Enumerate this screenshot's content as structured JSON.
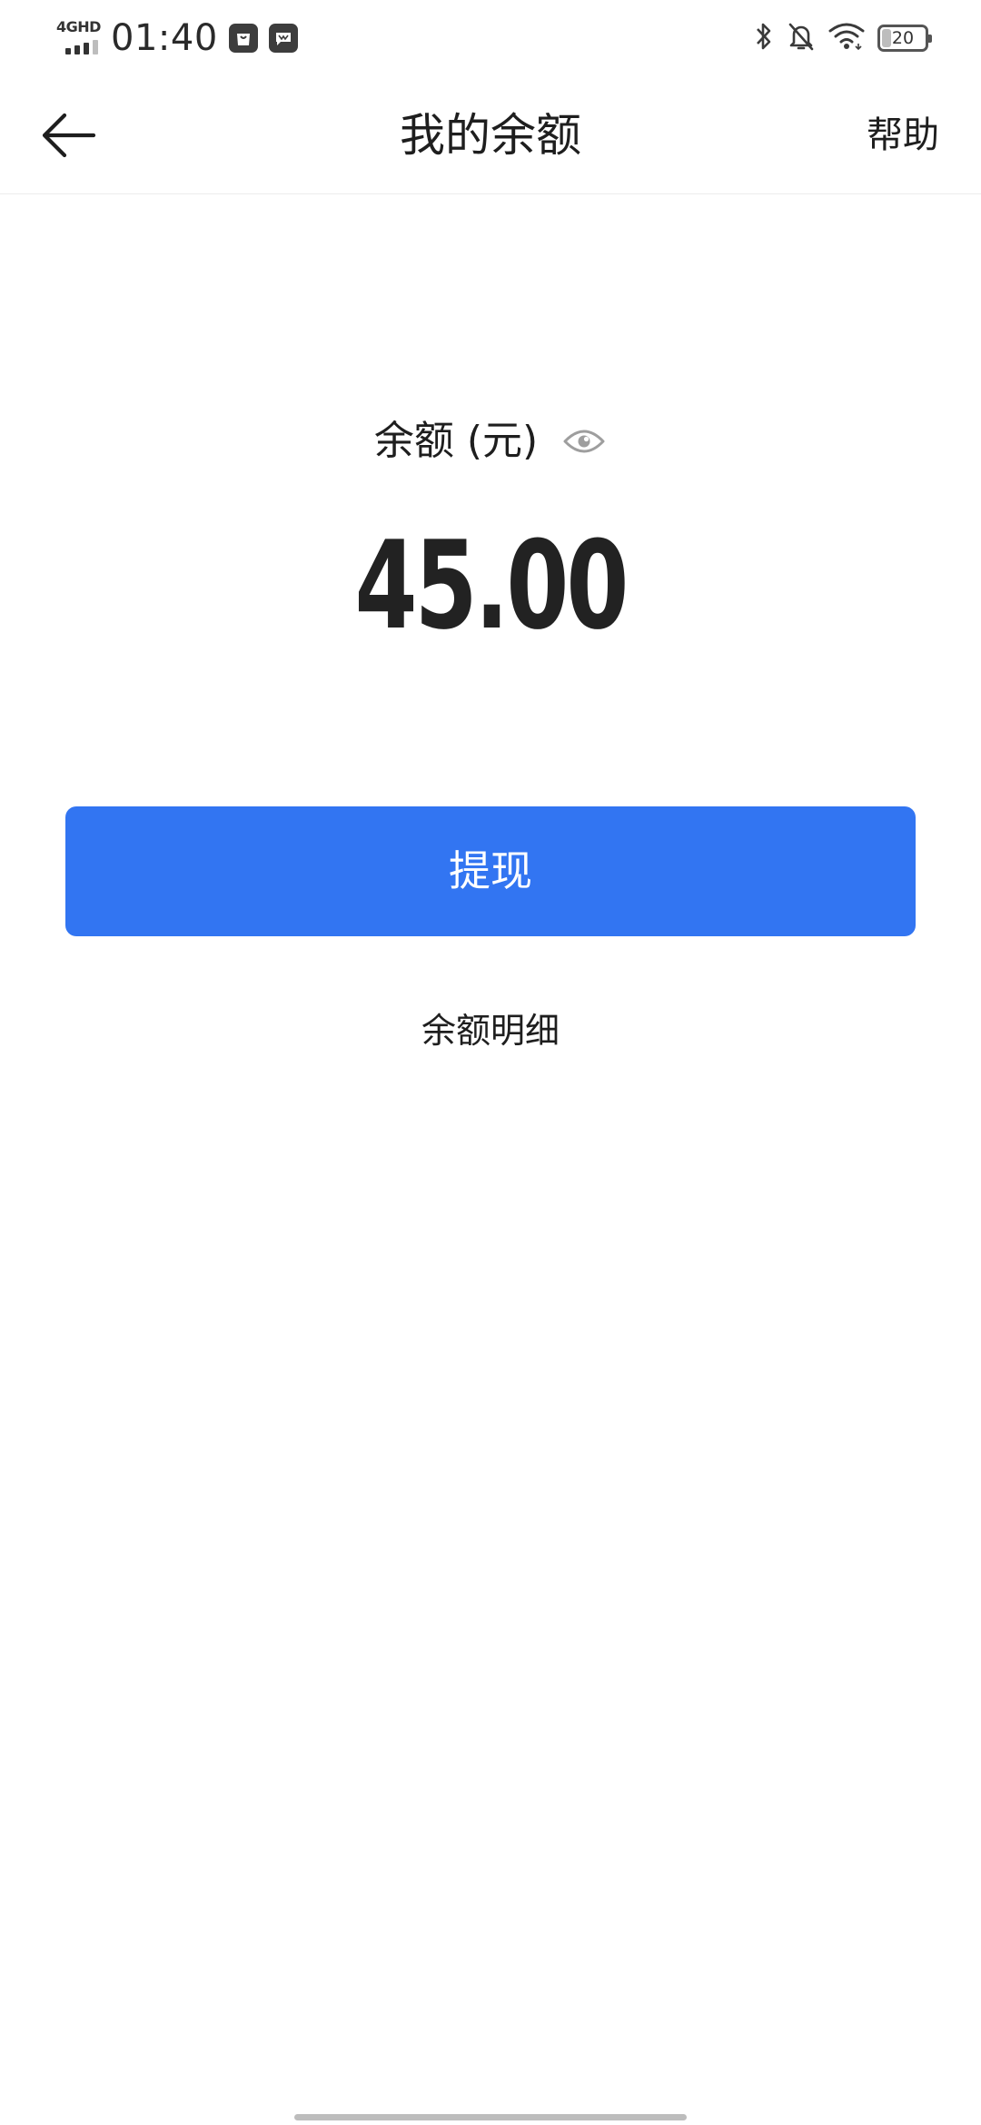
{
  "status_bar": {
    "network": "4GHD",
    "time": "01:40",
    "battery_level": "20",
    "icons": [
      "signal-icon",
      "shopping-bag-icon",
      "chat-app-icon",
      "bluetooth-icon",
      "bell-muted-icon",
      "wifi-icon",
      "battery-icon"
    ]
  },
  "header": {
    "title": "我的余额",
    "help_label": "帮助",
    "back_icon": "arrow-left-icon"
  },
  "balance": {
    "label": "余额 (元)",
    "amount": "45.00",
    "visibility_icon": "eye-icon"
  },
  "actions": {
    "withdraw_label": "提现",
    "details_label": "余额明细"
  },
  "colors": {
    "primary": "#3275f2",
    "text": "#1e1e1e",
    "background": "#ffffff",
    "muted_icon": "#9e9e9e"
  }
}
